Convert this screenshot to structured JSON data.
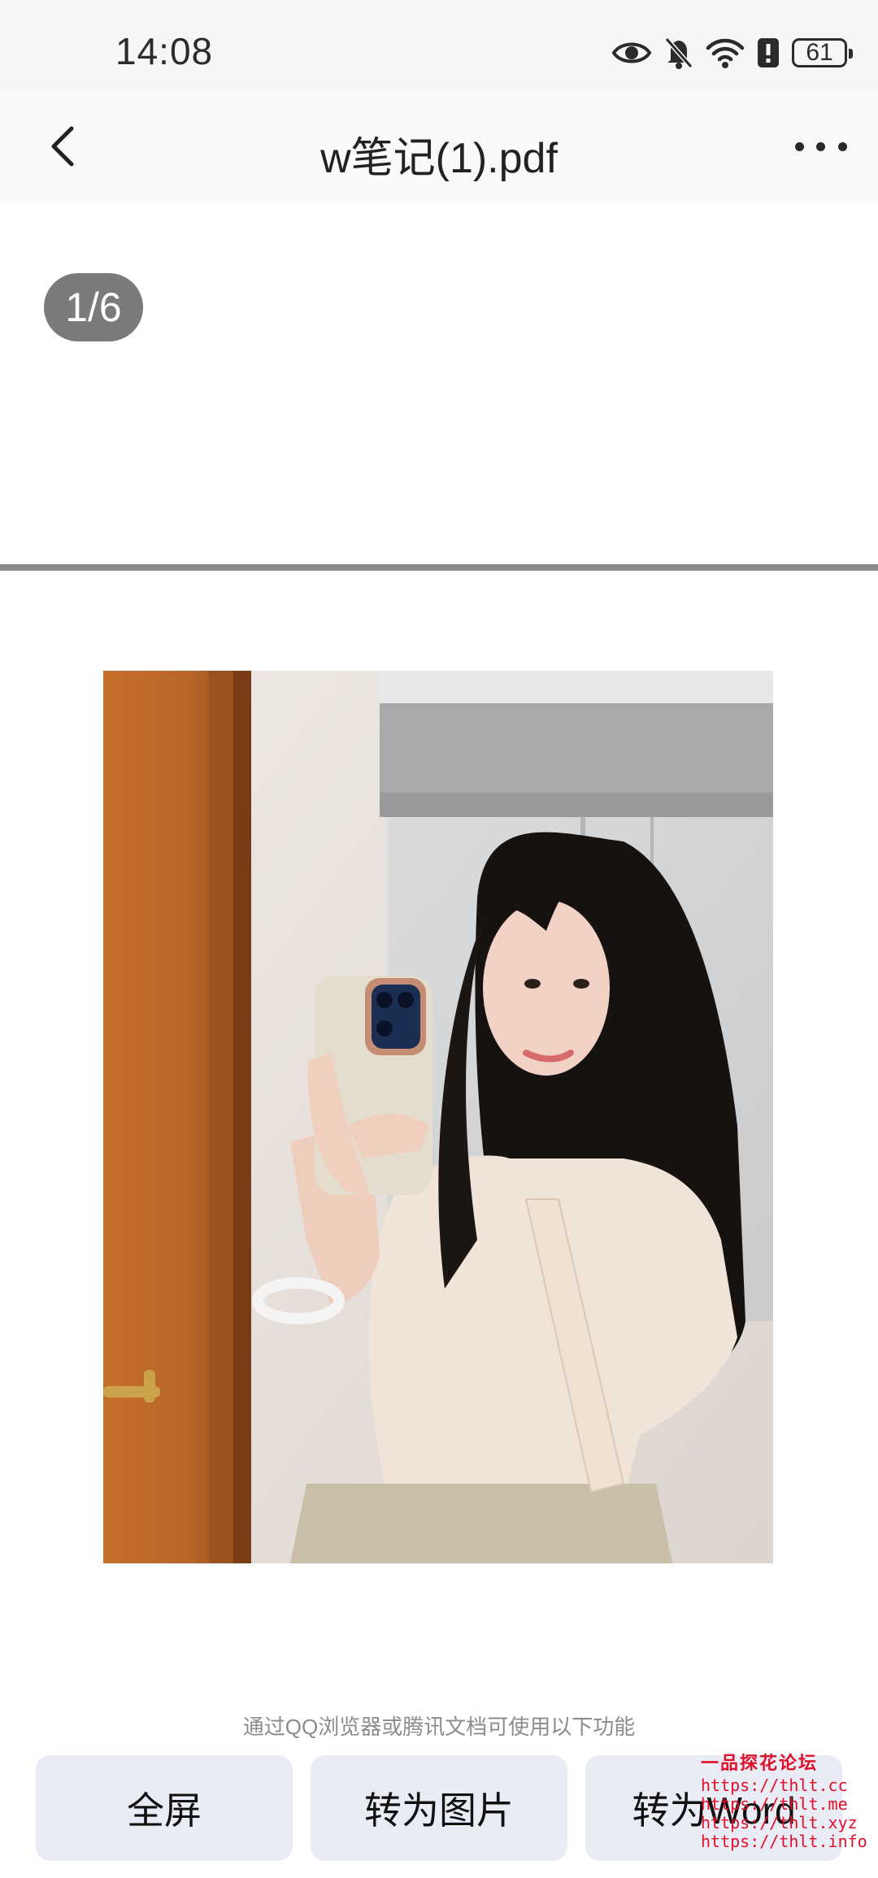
{
  "status_bar": {
    "time": "14:08",
    "battery_level": "61",
    "icons": [
      "eye-icon",
      "bell-off-icon",
      "wifi-icon",
      "battery-alert-icon",
      "battery-icon"
    ]
  },
  "nav": {
    "title": "w笔记(1).pdf",
    "back_icon": "chevron-left-icon",
    "more_icon": "more-horizontal-icon"
  },
  "viewer": {
    "page_indicator": "1/6",
    "current_page": 1,
    "total_pages": 6
  },
  "footer": {
    "hint": "通过QQ浏览器或腾讯文档可使用以下功能",
    "buttons": [
      {
        "label": "全屏"
      },
      {
        "label": "转为图片"
      },
      {
        "label": "转为Word"
      }
    ]
  },
  "watermark": {
    "title": "一品探花论坛",
    "urls": [
      "https://thlt.cc",
      "https://thlt.me",
      "https://thlt.xyz",
      "https://thlt.info"
    ]
  },
  "colors": {
    "status_bar_bg": "#f6f6f6",
    "nav_bg": "#f9f9f9",
    "page_indicator_bg": "#7a7a7a",
    "action_button_bg": "#e9ecf4",
    "watermark": "#e0102a"
  }
}
